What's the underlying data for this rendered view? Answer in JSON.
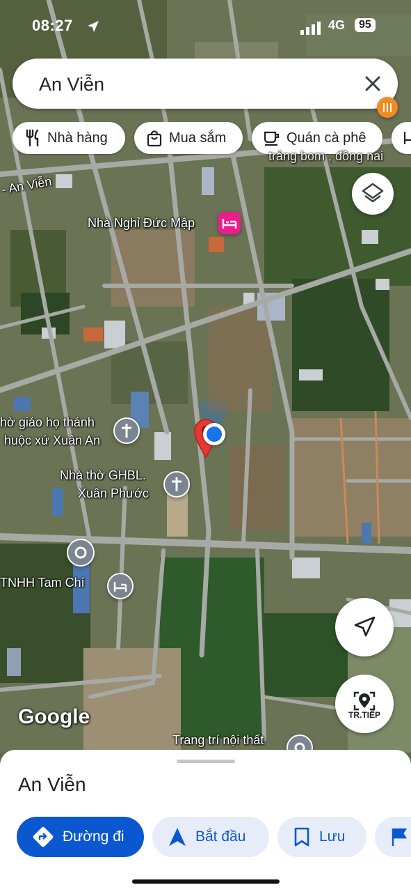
{
  "status_bar": {
    "time": "08:27",
    "network": "4G",
    "battery": "95"
  },
  "search": {
    "value": "An Viễn"
  },
  "chips": [
    {
      "label": "Nhà hàng",
      "icon": "fork-knife-icon"
    },
    {
      "label": "Mua sắm",
      "icon": "shopping-bag-icon"
    },
    {
      "label": "Quán cà phê",
      "icon": "coffee-cup-icon"
    }
  ],
  "map_labels": {
    "road_an_vien": "- An Viễn",
    "hotel": "Nhà Nghỉ Đức Mập",
    "church1_line1": "hờ giáo họ thánh",
    "church1_line2": "huộc xứ Xuân An",
    "church2_line1": "Nhà thờ GHBL.",
    "church2_line2": "Xuân Phước",
    "company": "TNHH Tam Chí",
    "partial_top": "trảng bom , đồng nai",
    "interior": "Trang trí nội thất",
    "google": "Google"
  },
  "live_view_label": "TR.TIẾP",
  "sheet": {
    "title": "An Viễn",
    "actions": [
      {
        "label": "Đường đi",
        "icon": "directions-icon"
      },
      {
        "label": "Bắt đầu",
        "icon": "navigation-arrow-icon"
      },
      {
        "label": "Lưu",
        "icon": "bookmark-icon"
      }
    ]
  },
  "colors": {
    "primary": "#0b57d0",
    "secondary_bg": "#e7edf8",
    "pin_red": "#e53935",
    "location_blue": "#1a73e8",
    "hotel_pink": "#e91e8c"
  }
}
